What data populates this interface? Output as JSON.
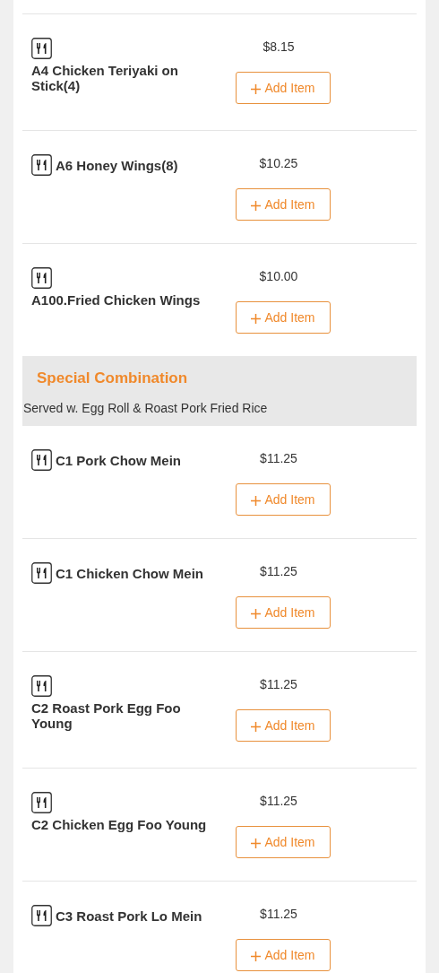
{
  "sections": [
    {
      "kind": "items",
      "items": [
        {
          "name": "A4 Chicken Teriyaki on Stick(4)",
          "price": "$8.15",
          "button": "Add Item"
        },
        {
          "name": "A6 Honey Wings(8)",
          "price": "$10.25",
          "button": "Add Item"
        },
        {
          "name": "A100.Fried Chicken Wings",
          "price": "$10.00",
          "button": "Add Item"
        }
      ]
    },
    {
      "kind": "category",
      "title": "Special Combination",
      "description": "Served w. Egg Roll & Roast Pork Fried Rice",
      "items": [
        {
          "name": "C1 Pork Chow Mein",
          "price": "$11.25",
          "button": "Add Item"
        },
        {
          "name": "C1 Chicken Chow Mein",
          "price": "$11.25",
          "button": "Add Item"
        },
        {
          "name": "C2 Roast Pork Egg Foo Young",
          "price": "$11.25",
          "button": "Add Item"
        },
        {
          "name": "C2 Chicken Egg Foo Young",
          "price": "$11.25",
          "button": "Add Item"
        },
        {
          "name": "C3 Roast Pork Lo Mein",
          "price": "$11.25",
          "button": "Add Item"
        }
      ]
    }
  ]
}
